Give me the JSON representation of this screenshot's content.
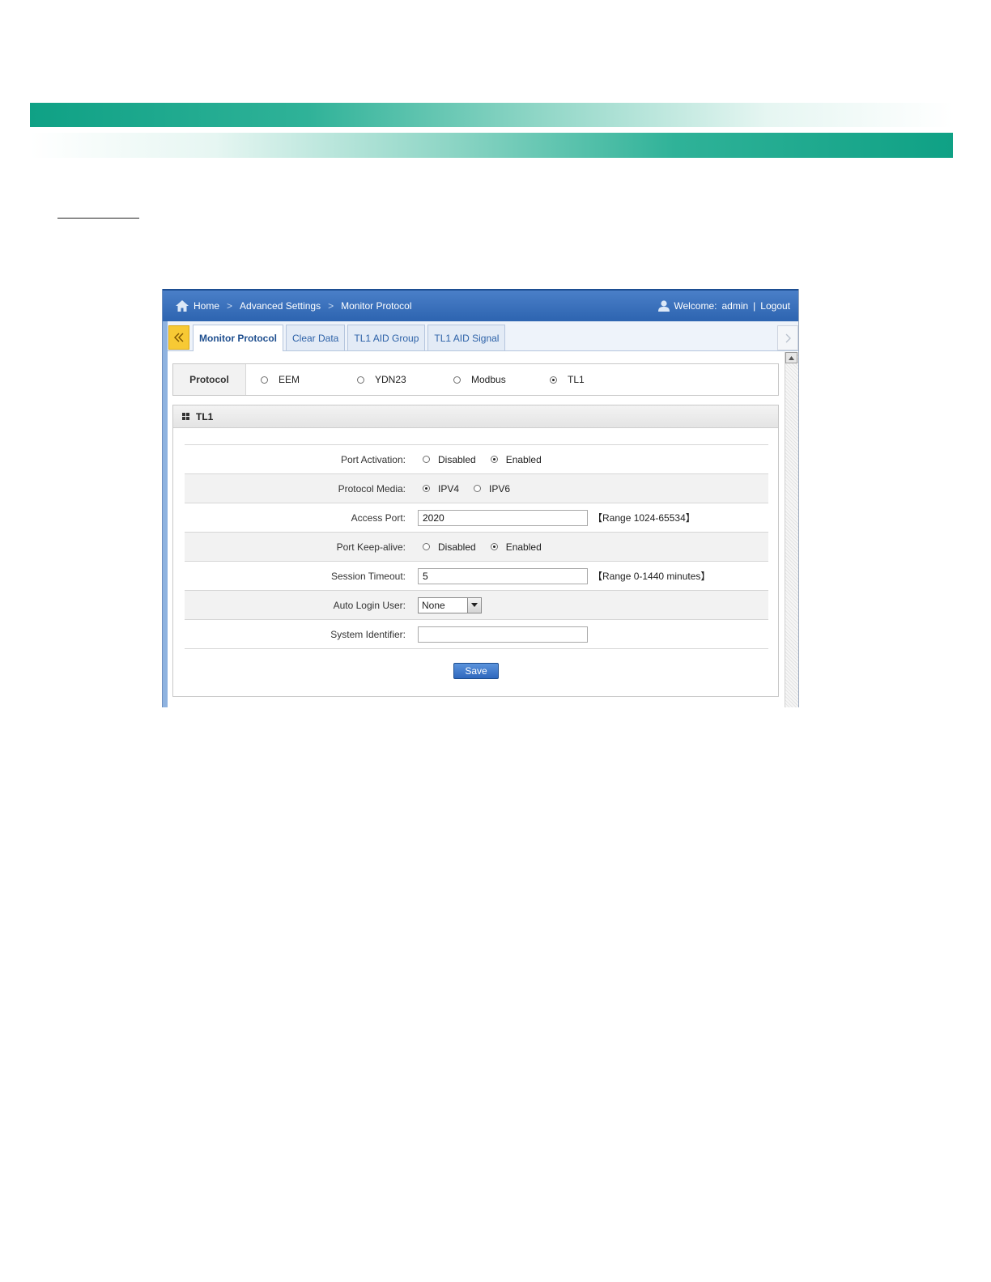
{
  "breadcrumb": {
    "home": "Home",
    "advanced": "Advanced Settings",
    "current": "Monitor Protocol"
  },
  "user": {
    "welcome": "Welcome:",
    "name": "admin",
    "separator": "|",
    "logout": "Logout"
  },
  "tabs": [
    {
      "label": "Monitor Protocol",
      "active": true
    },
    {
      "label": "Clear Data",
      "active": false
    },
    {
      "label": "TL1 AID Group",
      "active": false
    },
    {
      "label": "TL1 AID Signal",
      "active": false
    }
  ],
  "protocol": {
    "label": "Protocol",
    "options": [
      {
        "label": "EEM",
        "selected": false
      },
      {
        "label": "YDN23",
        "selected": false
      },
      {
        "label": "Modbus",
        "selected": false
      },
      {
        "label": "TL1",
        "selected": true
      }
    ]
  },
  "panel": {
    "title": "TL1",
    "port_activation": {
      "label": "Port Activation:",
      "disabled": "Disabled",
      "enabled": "Enabled",
      "value": "Enabled"
    },
    "protocol_media": {
      "label": "Protocol Media:",
      "ipv4": "IPV4",
      "ipv6": "IPV6",
      "value": "IPV4"
    },
    "access_port": {
      "label": "Access Port:",
      "value": "2020",
      "hint": "【Range 1024-65534】"
    },
    "port_keepalive": {
      "label": "Port Keep-alive:",
      "disabled": "Disabled",
      "enabled": "Enabled",
      "value": "Enabled"
    },
    "session_timeout": {
      "label": "Session Timeout:",
      "value": "5",
      "hint": "【Range 0-1440 minutes】"
    },
    "auto_login_user": {
      "label": "Auto Login User:",
      "value": "None"
    },
    "system_identifier": {
      "label": "System Identifier:",
      "value": ""
    },
    "save_label": "Save"
  },
  "colors": {
    "header_blue": "#2d64b0",
    "band_teal": "#0fa185",
    "tab_nav_yellow": "#f7c934"
  },
  "icons": [
    "home-icon",
    "chevron-right-icon",
    "user-icon",
    "double-chevron-left-icon",
    "chevron-right-icon",
    "grid-icon",
    "scroll-up-arrow-icon",
    "dropdown-arrow-icon"
  ]
}
